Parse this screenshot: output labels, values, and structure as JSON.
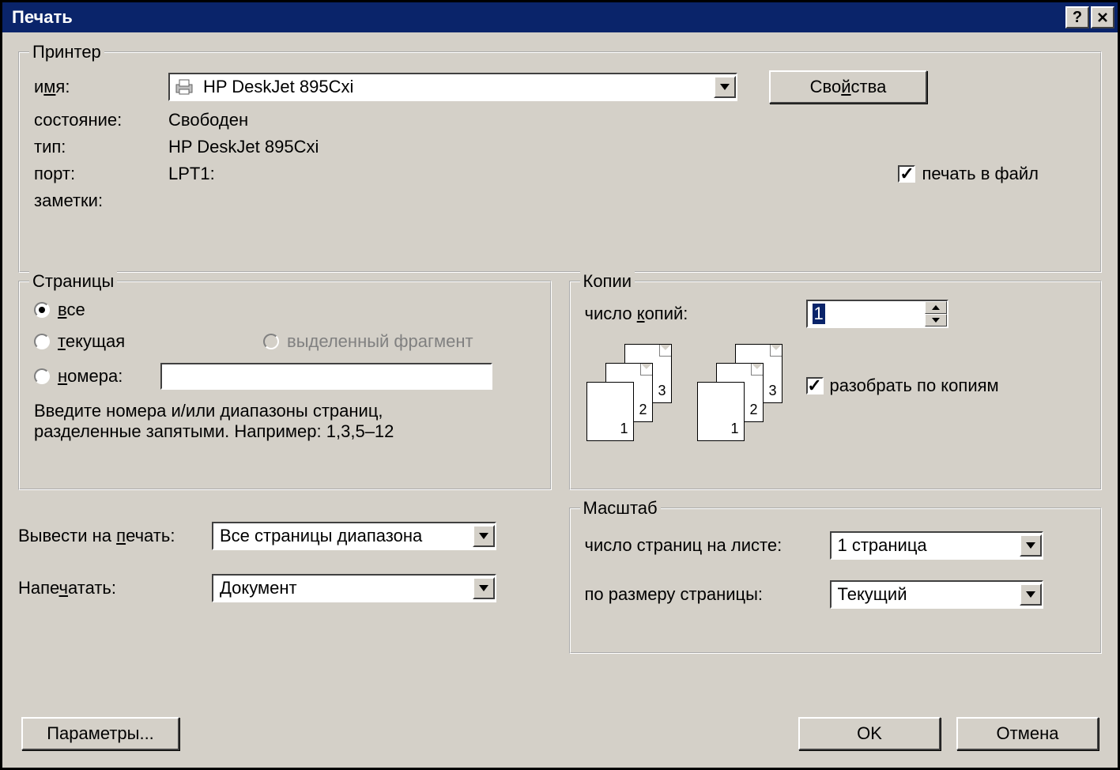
{
  "title": "Печать",
  "printer": {
    "legend": "Принтер",
    "name_label_pre": "и",
    "name_label_letter": "м",
    "name_label_post": "я:",
    "name_value": "HP DeskJet 895Cxi",
    "properties_pre": "Сво",
    "properties_letter": "й",
    "properties_post": "ства",
    "status_label": "состояние:",
    "status_value": "Свободен",
    "type_label": "тип:",
    "type_value": "HP DeskJet 895Cxi",
    "port_label": "порт:",
    "port_value": "LPT1:",
    "notes_label": "заметки:",
    "print_to_file_label": "печать в файл"
  },
  "pages": {
    "legend": "Страницы",
    "all_letter": "в",
    "all_post": "се",
    "current_letter": "т",
    "current_post": "екущая",
    "selection_label": "выделенный фрагмент",
    "numbers_letter": "н",
    "numbers_post": "омера:",
    "hint1": "Введите номера и/или диапазоны страниц,",
    "hint2": "разделенные запятыми. Например: 1,3,5–12"
  },
  "copies": {
    "legend": "Копии",
    "count_pre": "число ",
    "count_letter": "к",
    "count_post": "опий:",
    "count_value": "1",
    "collate_label": "разобрать по копиям"
  },
  "output": {
    "print_scope_pre": "Вывести на ",
    "print_scope_letter": "п",
    "print_scope_post": "ечать:",
    "print_scope_value": "Все страницы диапазона",
    "print_what_pre": "Напе",
    "print_what_letter": "ч",
    "print_what_post": "атать:",
    "print_what_value": "Документ"
  },
  "scale": {
    "legend": "Масштаб",
    "pages_per_sheet_label": "число страниц на листе:",
    "pages_per_sheet_value": "1 страница",
    "fit_to_label": "по размеру страницы:",
    "fit_to_value": "Текущий"
  },
  "buttons": {
    "options": "Параметры...",
    "ok": "OK",
    "cancel": "Отмена"
  }
}
